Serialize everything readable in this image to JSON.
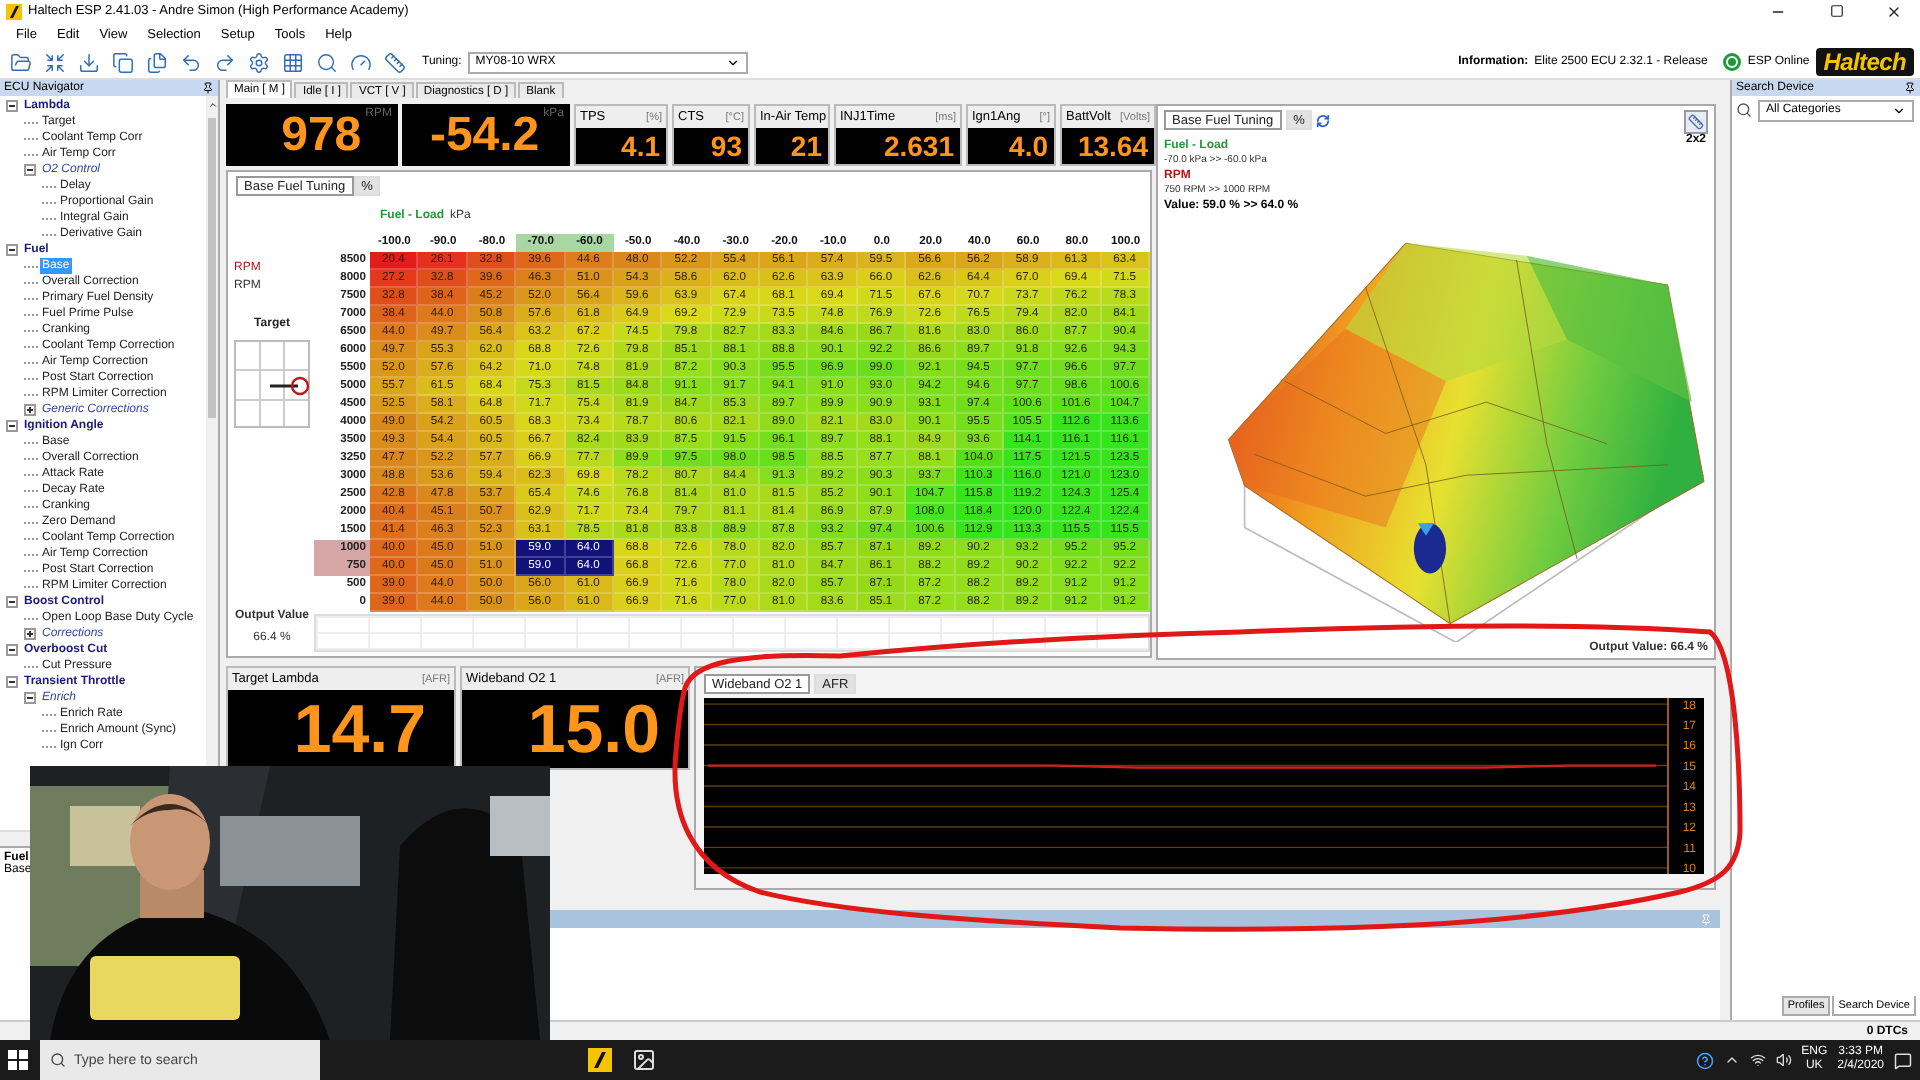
{
  "window": {
    "title": "Haltech ESP 2.41.03 - Andre Simon (High Performance Academy)"
  },
  "menu": [
    "File",
    "Edit",
    "View",
    "Selection",
    "Setup",
    "Tools",
    "Help"
  ],
  "toolbar": {
    "tuning_label": "Tuning:",
    "tuning_value": "MY08-10 WRX",
    "information_label": "Information:",
    "information_value": "Elite 2500 ECU 2.32.1 - Release",
    "status": "ESP Online",
    "online": true,
    "logo": "Haltech"
  },
  "navigator": {
    "title": "ECU Navigator",
    "footer_title": "Fuel",
    "footer_text": "Base",
    "tree": [
      {
        "label": "Lambda",
        "kind": "category",
        "expanded": true,
        "selected": false,
        "children": [
          {
            "label": "Target",
            "kind": "item",
            "selected": false
          },
          {
            "label": "Coolant Temp Corr",
            "kind": "item",
            "selected": false
          },
          {
            "label": "Air Temp Corr",
            "kind": "item",
            "selected": false
          },
          {
            "label": "O2 Control",
            "kind": "group",
            "expanded": true,
            "selected": false,
            "children": [
              {
                "label": "Delay",
                "kind": "item",
                "selected": false
              },
              {
                "label": "Proportional Gain",
                "kind": "item",
                "selected": false
              },
              {
                "label": "Integral Gain",
                "kind": "item",
                "selected": false
              },
              {
                "label": "Derivative Gain",
                "kind": "item",
                "selected": false
              }
            ]
          }
        ]
      },
      {
        "label": "Fuel",
        "kind": "category",
        "expanded": true,
        "selected": false,
        "children": [
          {
            "label": "Base",
            "kind": "item",
            "selected": true
          },
          {
            "label": "Overall Correction",
            "kind": "item",
            "selected": false
          },
          {
            "label": "Primary Fuel Density",
            "kind": "item",
            "selected": false
          },
          {
            "label": "Fuel Prime Pulse",
            "kind": "item",
            "selected": false
          },
          {
            "label": "Cranking",
            "kind": "item",
            "selected": false
          },
          {
            "label": "Coolant Temp Correction",
            "kind": "item",
            "selected": false
          },
          {
            "label": "Air Temp Correction",
            "kind": "item",
            "selected": false
          },
          {
            "label": "Post Start Correction",
            "kind": "item",
            "selected": false
          },
          {
            "label": "RPM Limiter Correction",
            "kind": "item",
            "selected": false
          },
          {
            "label": "Generic Corrections",
            "kind": "group",
            "expanded": false,
            "selected": false
          }
        ]
      },
      {
        "label": "Ignition Angle",
        "kind": "category",
        "expanded": true,
        "selected": false,
        "children": [
          {
            "label": "Base",
            "kind": "item",
            "selected": false
          },
          {
            "label": "Overall Correction",
            "kind": "item",
            "selected": false
          },
          {
            "label": "Attack Rate",
            "kind": "item",
            "selected": false
          },
          {
            "label": "Decay Rate",
            "kind": "item",
            "selected": false
          },
          {
            "label": "Cranking",
            "kind": "item",
            "selected": false
          },
          {
            "label": "Zero Demand",
            "kind": "item",
            "selected": false
          },
          {
            "label": "Coolant Temp Correction",
            "kind": "item",
            "selected": false
          },
          {
            "label": "Air Temp Correction",
            "kind": "item",
            "selected": false
          },
          {
            "label": "Post Start Correction",
            "kind": "item",
            "selected": false
          },
          {
            "label": "RPM Limiter Correction",
            "kind": "item",
            "selected": false
          }
        ]
      },
      {
        "label": "Boost Control",
        "kind": "category",
        "expanded": true,
        "selected": false,
        "children": [
          {
            "label": "Open Loop Base Duty Cycle",
            "kind": "item",
            "selected": false
          },
          {
            "label": "Corrections",
            "kind": "group",
            "expanded": false,
            "selected": false
          }
        ]
      },
      {
        "label": "Overboost Cut",
        "kind": "category",
        "expanded": true,
        "selected": false,
        "children": [
          {
            "label": "Cut Pressure",
            "kind": "item",
            "selected": false
          }
        ]
      },
      {
        "label": "Transient Throttle",
        "kind": "category",
        "expanded": true,
        "selected": false,
        "children": [
          {
            "label": "Enrich",
            "kind": "group",
            "expanded": true,
            "selected": false,
            "children": [
              {
                "label": "Enrich Rate",
                "kind": "item",
                "selected": false
              },
              {
                "label": "Enrich Amount (Sync)",
                "kind": "item",
                "selected": false
              },
              {
                "label": "Ign Corr",
                "kind": "item",
                "selected": false
              }
            ]
          }
        ]
      }
    ]
  },
  "main_tabs": [
    {
      "label": "Main [ M ]",
      "selected": true
    },
    {
      "label": "Idle [ I ]",
      "selected": false
    },
    {
      "label": "VCT [ V ]",
      "selected": false
    },
    {
      "label": "Diagnostics [ D ]",
      "selected": false
    },
    {
      "label": "Blank",
      "selected": false
    }
  ],
  "gauges": [
    {
      "kind": "large",
      "unit": "RPM",
      "value": "978"
    },
    {
      "kind": "large",
      "unit": "kPa",
      "value": "-54.2"
    },
    {
      "kind": "small",
      "label": "TPS",
      "unit": "[%]",
      "value": "4.1"
    },
    {
      "kind": "small",
      "label": "CTS",
      "unit": "[°C]",
      "value": "93"
    },
    {
      "kind": "small",
      "label": "In-Air Temp",
      "value": "21"
    },
    {
      "kind": "small",
      "label": "INJ1Time",
      "unit": "[ms]",
      "value": "2.631"
    },
    {
      "kind": "small",
      "label": "Ign1Ang",
      "unit": "[°]",
      "value": "4.0"
    },
    {
      "kind": "small",
      "label": "BattVolt",
      "unit": "[Volts]",
      "value": "13.64"
    }
  ],
  "fuel_table": {
    "tabs": [
      {
        "label": "Base Fuel Tuning",
        "selected": true
      },
      {
        "label": "%",
        "selected": false
      }
    ],
    "axis_title": "Fuel - Load",
    "axis_unit": "kPa",
    "row_axis_labels": [
      "RPM",
      "RPM"
    ],
    "target_label": "Target",
    "output_label": "Output Value",
    "output_value": "66.4 %",
    "columns": [
      {
        "label": "-100.0",
        "selected": false
      },
      {
        "label": "-90.0",
        "selected": false
      },
      {
        "label": "-80.0",
        "selected": false
      },
      {
        "label": "-70.0",
        "selected": true
      },
      {
        "label": "-60.0",
        "selected": true
      },
      {
        "label": "-50.0",
        "selected": false
      },
      {
        "label": "-40.0",
        "selected": false
      },
      {
        "label": "-30.0",
        "selected": false
      },
      {
        "label": "-20.0",
        "selected": false
      },
      {
        "label": "-10.0",
        "selected": false
      },
      {
        "label": "0.0",
        "selected": false
      },
      {
        "label": "20.0",
        "selected": false
      },
      {
        "label": "40.0",
        "selected": false
      },
      {
        "label": "60.0",
        "selected": false
      },
      {
        "label": "80.0",
        "selected": false
      },
      {
        "label": "100.0",
        "selected": false
      }
    ],
    "rows": [
      {
        "rpm": "8500",
        "selected": false,
        "values": [
          "20.4",
          "26.1",
          "32.8",
          "39.6",
          "44.6",
          "48.0",
          "52.2",
          "55.4",
          "56.1",
          "57.4",
          "59.5",
          "56.6",
          "56.2",
          "58.9",
          "61.3",
          "63.4"
        ]
      },
      {
        "rpm": "8000",
        "selected": false,
        "values": [
          "27.2",
          "32.8",
          "39.6",
          "46.3",
          "51.0",
          "54.3",
          "58.6",
          "62.0",
          "62.6",
          "63.9",
          "66.0",
          "62.6",
          "64.4",
          "67.0",
          "69.4",
          "71.5"
        ]
      },
      {
        "rpm": "7500",
        "selected": false,
        "values": [
          "32.8",
          "38.4",
          "45.2",
          "52.0",
          "56.4",
          "59.6",
          "63.9",
          "67.4",
          "68.1",
          "69.4",
          "71.5",
          "67.6",
          "70.7",
          "73.7",
          "76.2",
          "78.3"
        ]
      },
      {
        "rpm": "7000",
        "selected": false,
        "values": [
          "38.4",
          "44.0",
          "50.8",
          "57.6",
          "61.8",
          "64.9",
          "69.2",
          "72.9",
          "73.5",
          "74.8",
          "76.9",
          "72.6",
          "76.5",
          "79.4",
          "82.0",
          "84.1"
        ]
      },
      {
        "rpm": "6500",
        "selected": false,
        "values": [
          "44.0",
          "49.7",
          "56.4",
          "63.2",
          "67.2",
          "74.5",
          "79.8",
          "82.7",
          "83.3",
          "84.6",
          "86.7",
          "81.6",
          "83.0",
          "86.0",
          "87.7",
          "90.4"
        ]
      },
      {
        "rpm": "6000",
        "selected": false,
        "values": [
          "49.7",
          "55.3",
          "62.0",
          "68.8",
          "72.6",
          "79.8",
          "85.1",
          "88.1",
          "88.8",
          "90.1",
          "92.2",
          "86.6",
          "89.7",
          "91.8",
          "92.6",
          "94.3"
        ]
      },
      {
        "rpm": "5500",
        "selected": false,
        "values": [
          "52.0",
          "57.6",
          "64.2",
          "71.0",
          "74.8",
          "81.9",
          "87.2",
          "90.3",
          "95.5",
          "96.9",
          "99.0",
          "92.1",
          "94.5",
          "97.7",
          "96.6",
          "97.7"
        ]
      },
      {
        "rpm": "5000",
        "selected": false,
        "values": [
          "55.7",
          "61.5",
          "68.4",
          "75.3",
          "81.5",
          "84.8",
          "91.1",
          "91.7",
          "94.1",
          "91.0",
          "93.0",
          "94.2",
          "94.6",
          "97.7",
          "98.6",
          "100.6"
        ]
      },
      {
        "rpm": "4500",
        "selected": false,
        "values": [
          "52.5",
          "58.1",
          "64.8",
          "71.7",
          "75.4",
          "81.9",
          "84.7",
          "85.3",
          "89.7",
          "89.9",
          "90.9",
          "93.1",
          "97.4",
          "100.6",
          "101.6",
          "104.7"
        ]
      },
      {
        "rpm": "4000",
        "selected": false,
        "values": [
          "49.0",
          "54.2",
          "60.5",
          "68.3",
          "73.4",
          "78.7",
          "80.6",
          "82.1",
          "89.0",
          "82.1",
          "83.0",
          "90.1",
          "95.5",
          "105.5",
          "112.6",
          "113.6"
        ]
      },
      {
        "rpm": "3500",
        "selected": false,
        "values": [
          "49.3",
          "54.4",
          "60.5",
          "66.7",
          "82.4",
          "83.9",
          "87.5",
          "91.5",
          "96.1",
          "89.7",
          "88.1",
          "84.9",
          "93.6",
          "114.1",
          "116.1",
          "116.1"
        ]
      },
      {
        "rpm": "3250",
        "selected": false,
        "values": [
          "47.7",
          "52.2",
          "57.7",
          "66.9",
          "77.7",
          "89.9",
          "97.5",
          "98.0",
          "98.5",
          "88.5",
          "87.7",
          "88.1",
          "104.0",
          "117.5",
          "121.5",
          "123.5"
        ]
      },
      {
        "rpm": "3000",
        "selected": false,
        "values": [
          "48.8",
          "53.6",
          "59.4",
          "62.3",
          "69.8",
          "78.2",
          "80.7",
          "84.4",
          "91.3",
          "89.2",
          "90.3",
          "93.7",
          "110.3",
          "116.0",
          "121.0",
          "123.0"
        ]
      },
      {
        "rpm": "2500",
        "selected": false,
        "values": [
          "42.8",
          "47.8",
          "53.7",
          "65.4",
          "74.6",
          "76.8",
          "81.4",
          "81.0",
          "81.5",
          "85.2",
          "90.1",
          "104.7",
          "115.8",
          "119.2",
          "124.3",
          "125.4"
        ]
      },
      {
        "rpm": "2000",
        "selected": false,
        "values": [
          "40.4",
          "45.1",
          "50.7",
          "62.9",
          "71.7",
          "73.4",
          "79.7",
          "81.1",
          "81.4",
          "86.9",
          "87.9",
          "108.0",
          "118.4",
          "120.0",
          "122.4",
          "122.4"
        ]
      },
      {
        "rpm": "1500",
        "selected": false,
        "values": [
          "41.4",
          "46.3",
          "52.3",
          "63.1",
          "78.5",
          "81.8",
          "83.8",
          "88.9",
          "87.8",
          "93.2",
          "97.4",
          "100.6",
          "112.9",
          "113.3",
          "115.5",
          "115.5"
        ]
      },
      {
        "rpm": "1000",
        "selected": true,
        "values": [
          "40.0",
          "45.0",
          "51.0",
          "59.0",
          "64.0",
          "68.8",
          "72.6",
          "78.0",
          "82.0",
          "85.7",
          "87.1",
          "89.2",
          "90.2",
          "93.2",
          "95.2",
          "95.2"
        ]
      },
      {
        "rpm": "750",
        "selected": true,
        "values": [
          "40.0",
          "45.0",
          "51.0",
          "59.0",
          "64.0",
          "66.8",
          "72.6",
          "77.0",
          "81.0",
          "84.7",
          "86.1",
          "88.2",
          "89.2",
          "90.2",
          "92.2",
          "92.2"
        ]
      },
      {
        "rpm": "500",
        "selected": false,
        "values": [
          "39.0",
          "44.0",
          "50.0",
          "56.0",
          "61.0",
          "66.9",
          "71.6",
          "78.0",
          "82.0",
          "85.7",
          "87.1",
          "87.2",
          "88.2",
          "89.2",
          "91.2",
          "91.2"
        ]
      },
      {
        "rpm": "0",
        "selected": false,
        "values": [
          "39.0",
          "44.0",
          "50.0",
          "56.0",
          "61.0",
          "66.9",
          "71.6",
          "77.0",
          "81.0",
          "83.6",
          "85.1",
          "87.2",
          "88.2",
          "89.2",
          "91.2",
          "91.2"
        ]
      }
    ]
  },
  "surface_panel": {
    "tabs": [
      {
        "label": "Base Fuel Tuning",
        "selected": true
      },
      {
        "label": "%",
        "selected": false
      }
    ],
    "x_axis": "Fuel - Load",
    "x_range": "-70.0 kPa >> -60.0 kPa",
    "y_axis": "RPM",
    "y_range": "750 RPM >> 1000 RPM",
    "value": "Value: 59.0 % >> 64.0 %",
    "layout_button": "2x2",
    "output": "Output Value: 66.4 %"
  },
  "bottom_gauges": [
    {
      "label": "Target Lambda",
      "unit": "[AFR]",
      "value": "14.7"
    },
    {
      "label": "Wideband O2 1",
      "unit": "[AFR]",
      "value": "15.0"
    }
  ],
  "chart_panel": {
    "tabs": [
      {
        "label": "Wideband O2 1",
        "selected": true
      },
      {
        "label": "AFR",
        "selected": false
      }
    ],
    "chart_data": {
      "type": "line",
      "grid": true,
      "ylim": [
        9.7,
        18.3
      ],
      "yticks": [
        10,
        11,
        12,
        13,
        14,
        15,
        16,
        17,
        18
      ],
      "series": [
        {
          "color": "#d42020",
          "values": [
            15.0,
            15.0,
            15.0,
            15.0,
            15.0,
            14.9,
            14.9,
            14.9,
            14.9,
            14.9,
            15.0,
            15.0
          ]
        }
      ]
    }
  },
  "search_panel": {
    "title": "Search Device",
    "category": "All Categories",
    "tabs": [
      {
        "label": "Profiles",
        "selected": false
      },
      {
        "label": "Search Device",
        "selected": true
      }
    ]
  },
  "status_bar": {
    "dtcs": "0 DTCs"
  },
  "taskbar": {
    "search_placeholder": "Type here to search",
    "language": "ENG",
    "region": "UK",
    "time": "3:33 PM",
    "date": "2/4/2020"
  },
  "webcam": {
    "kind": "picture"
  }
}
